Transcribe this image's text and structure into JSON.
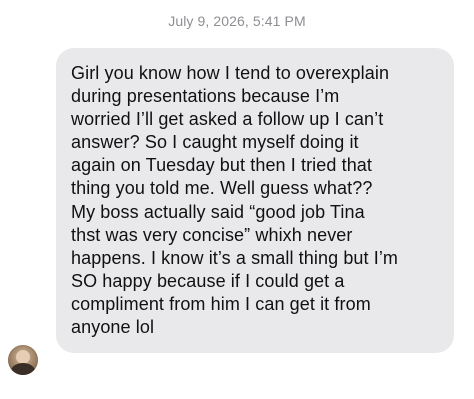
{
  "thread": {
    "timestamp": "July 9, 2026, 5:41 PM"
  },
  "message": {
    "sender_avatar_icon": "contact-photo",
    "text": "Girl you know how I tend to overexplain\nduring presentations because I’m\nworried I’ll get asked a follow up I can’t\nanswer? So I caught myself doing it\nagain on Tuesday but then I tried that\nthing you told me. Well guess what??\nMy boss actually said “good job Tina\nthst was very concise” whixh never\nhappens. I know it’s a small thing but I’m\nSO happy because if I could get a\ncompliment from him I can get it from\nanyone lol"
  },
  "colors": {
    "bubble_background": "#e9e9eb",
    "timestamp_text": "#8e8e93",
    "message_text": "#111111"
  }
}
